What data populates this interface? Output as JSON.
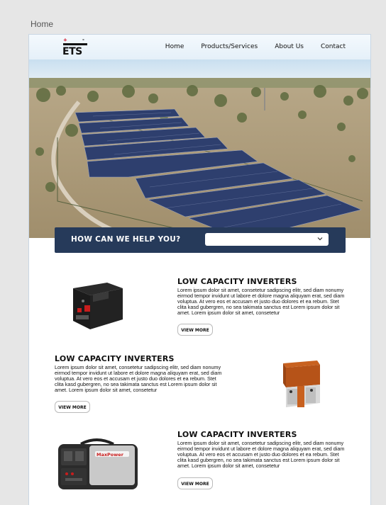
{
  "page_label": "Home",
  "nav": {
    "items": [
      "Home",
      "Products/Services",
      "About Us",
      "Contact"
    ]
  },
  "logo_text": "ETS",
  "hero": {
    "slide_count": 4
  },
  "help": {
    "title": "HOW CAN WE HELP YOU?",
    "select_value": ""
  },
  "products": [
    {
      "title": "LOW CAPACITY INVERTERS",
      "description": "Lorem ipsum dolor sit amet, consetetur sadipscing elitr, sed diam nonumy eirmod tempor invidunt ut labore et dolore magna aliquyam erat, sed diam voluptua. At vero eos et accusam et justo duo dolores et ea rebum. Stet clita kasd gubergren, no sea takimata sanctus est Lorem ipsum dolor sit amet. Lorem ipsum dolor sit amet, consetetur",
      "button": "VIEW MORE",
      "image": "inverter-unit"
    },
    {
      "title": "LOW CAPACITY INVERTERS",
      "description": "Lorem ipsum dolor sit amet, consetetur sadipscing elitr, sed diam nonumy eirmod tempor invidunt ut labore et dolore magna aliquyam erat, sed diam voluptua. At vero eos et accusam et justo duo dolores et ea rebum. Stet clita kasd gubergren, no sea takimata sanctus est Lorem ipsum dolor sit amet. Lorem ipsum dolor sit amet, consetetur",
      "button": "VIEW MORE",
      "image": "battery-unit"
    },
    {
      "title": "LOW CAPACITY INVERTERS",
      "description": "Lorem ipsum dolor sit amet, consetetur sadipscing elitr, sed diam nonumy eirmod tempor invidunt ut labore et dolore magna aliquyam erat, sed diam voluptua. At vero eos et accusam et justo duo dolores et ea rebum. Stet clita kasd gubergren, no sea takimata sanctus est Lorem ipsum dolor sit amet. Lorem ipsum dolor sit amet, consetetur",
      "button": "VIEW MORE",
      "image": "portable-power-station",
      "brand_text": "MaxPower"
    }
  ],
  "colors": {
    "help_bar": "#263a5a",
    "header_bg": "#e5f0f9",
    "logo_red": "#d0021b"
  }
}
